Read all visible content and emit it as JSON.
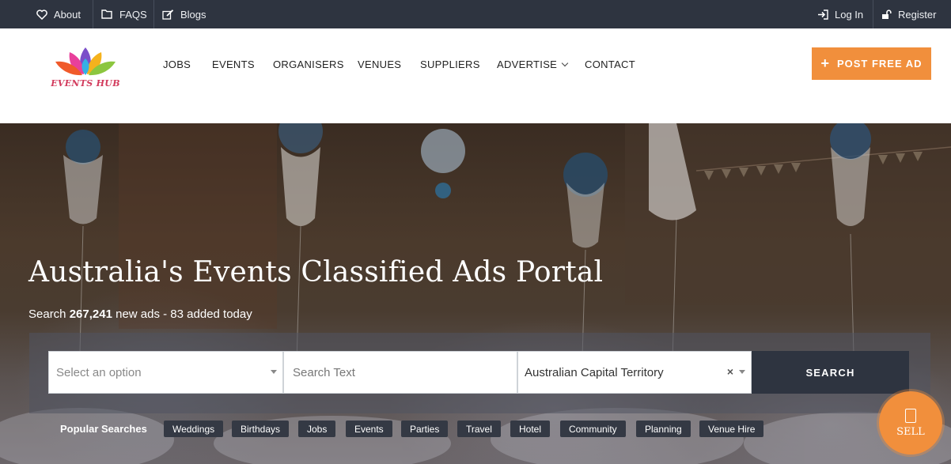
{
  "topbar": {
    "links": [
      {
        "label": "About",
        "icon": "heart-icon"
      },
      {
        "label": "FAQS",
        "icon": "folder-icon"
      },
      {
        "label": "Blogs",
        "icon": "edit-icon"
      }
    ],
    "auth": [
      {
        "label": "Log In",
        "icon": "sign-in-icon"
      },
      {
        "label": "Register",
        "icon": "unlock-icon"
      }
    ]
  },
  "header": {
    "logo_text": "EVENTS HUB",
    "nav": [
      "JOBS",
      "EVENTS",
      "ORGANISERS",
      "VENUES",
      "SUPPLIERS",
      "ADVERTISE",
      "CONTACT"
    ],
    "post_button": "POST FREE AD",
    "accent_color": "#f18f3c",
    "dark_color": "#2e3440"
  },
  "hero": {
    "title": "Australia's Events Classified Ads Portal",
    "sub_prefix": "Search",
    "ad_count": "267,241",
    "sub_suffix": "new ads - 83 added today",
    "search": {
      "category_placeholder": "Select an option",
      "text_placeholder": "Search Text",
      "location_value": "Australian Capital Territory",
      "clear_symbol": "×",
      "button_label": "SEARCH"
    },
    "popular_label": "Popular Searches",
    "popular_tags": [
      "Weddings",
      "Birthdays",
      "Jobs",
      "Events",
      "Parties",
      "Travel",
      "Hotel",
      "Community",
      "Planning",
      "Venue Hire"
    ]
  },
  "sell_button": "SELL"
}
